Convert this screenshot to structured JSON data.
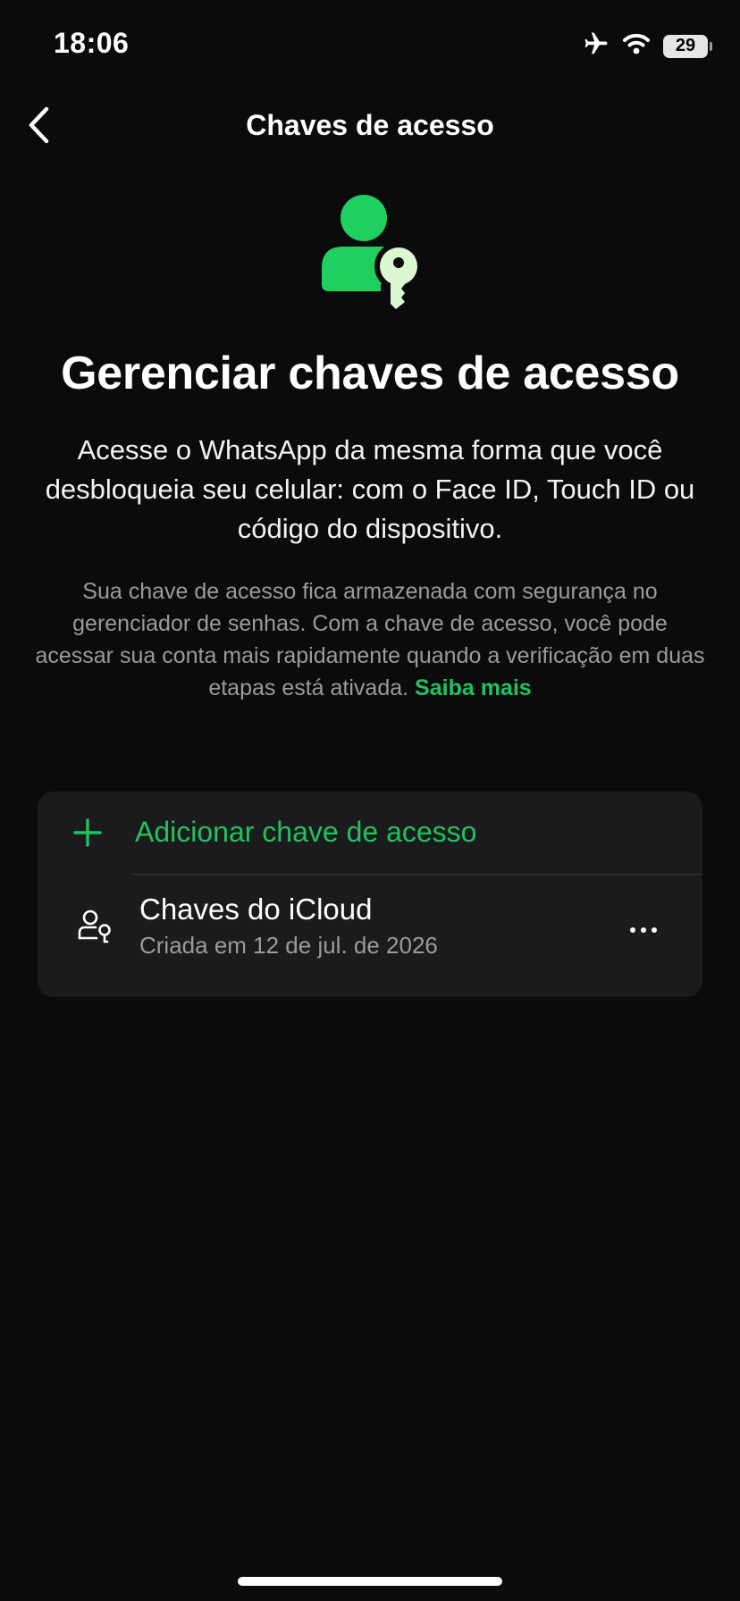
{
  "status_bar": {
    "time": "18:06",
    "battery_level": "29",
    "icons": [
      "airplane-icon",
      "wifi-icon",
      "battery-icon"
    ]
  },
  "nav": {
    "title": "Chaves de acesso",
    "back_icon": "chevron-left-icon"
  },
  "hero": {
    "icon": "person-key-icon",
    "headline": "Gerenciar chaves de acesso",
    "subhead": "Acesse o WhatsApp da mesma forma que você desbloqueia seu celular: com o Face ID, Touch ID ou código do dispositivo.",
    "body": "Sua chave de acesso fica armazenada com segurança no gerenciador de senhas. Com a chave de acesso, você pode acessar sua conta mais rapidamente quando a verificação em duas etapas está ativada.",
    "learn_more": "Saiba mais"
  },
  "passkeys": {
    "add_label": "Adicionar chave de acesso",
    "add_icon": "plus-icon",
    "items": [
      {
        "icon": "person-key-outline-icon",
        "name": "Chaves do iCloud",
        "created": "Criada em 12 de jul. de 2026",
        "more_icon": "more-horizontal-icon"
      }
    ]
  },
  "colors": {
    "background": "#0b0b0b",
    "card": "#1b1b1b",
    "accent": "#21c063",
    "icon_green": "#1fd060",
    "key_light": "#dcf8d2",
    "secondary_text": "#9b9b9b"
  }
}
